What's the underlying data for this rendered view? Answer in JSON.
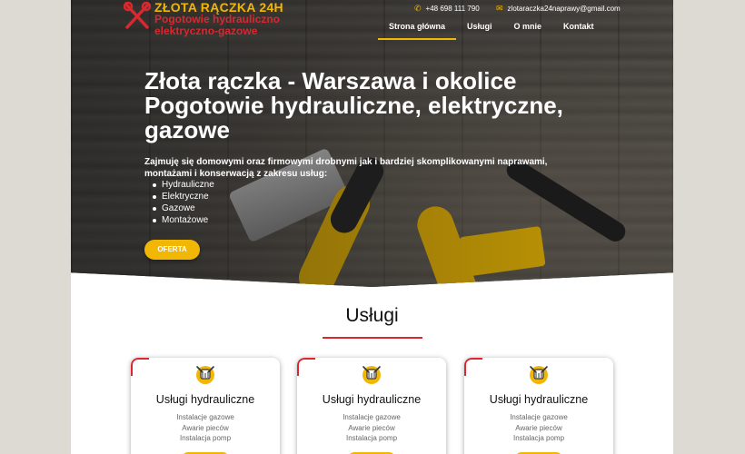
{
  "logo": {
    "line1": "ZŁOTA RĄCZKA 24H",
    "line2": "Pogotowie hydrauliczno",
    "line3": "elektryczno-gazowe"
  },
  "contact": {
    "phone": "+48 698 111 790",
    "email": "zlotaraczka24naprawy@gmail.com"
  },
  "nav": {
    "items": [
      "Strona główna",
      "Usługi",
      "O mnie",
      "Kontakt"
    ],
    "active": "Strona główna"
  },
  "hero": {
    "title": "Złota rączka - Warszawa i okolice Pogotowie hydrauliczne, elektryczne, gazowe",
    "description": "Zajmuję się domowymi oraz firmowymi drobnymi jak i bardziej skomplikowanymi naprawami, montażami i konserwacją z zakresu usług:",
    "services": [
      "Hydrauliczne",
      "Elektryczne",
      "Gazowe",
      "Montażowe"
    ],
    "button": "OFERTA"
  },
  "services_section": {
    "title": "Usługi",
    "cards": [
      {
        "title": "Usługi hydrauliczne",
        "items": [
          "Instalacje gazowe",
          "Awarie pieców",
          "Instalacja pomp"
        ]
      },
      {
        "title": "Usługi hydrauliczne",
        "items": [
          "Instalacje gazowe",
          "Awarie pieców",
          "Instalacja pomp"
        ]
      },
      {
        "title": "Usługi hydrauliczne",
        "items": [
          "Instalacje gazowe",
          "Awarie pieców",
          "Instalacja pomp"
        ]
      }
    ]
  },
  "colors": {
    "accent": "#f2b705",
    "brand_red": "#d9282f",
    "page_bg": "#dcdad2"
  },
  "icons": {
    "logo": "crossed-tools-icon",
    "phone": "phone-icon",
    "email": "envelope-icon",
    "card": "plumbing-tools-icon"
  }
}
